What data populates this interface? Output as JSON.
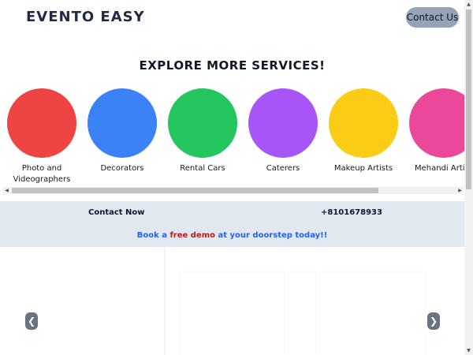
{
  "header": {
    "brand": "EVENTO EASY",
    "contact_button": "Contact Us"
  },
  "services": {
    "title": "EXPLORE MORE SERVICES!",
    "items": [
      {
        "label": "Photo and\nVideographers",
        "color": "#ef4444"
      },
      {
        "label": "Decorators",
        "color": "#3b82f6"
      },
      {
        "label": "Rental Cars",
        "color": "#22c55e"
      },
      {
        "label": "Caterers",
        "color": "#a855f7"
      },
      {
        "label": "Makeup Artists",
        "color": "#facc15"
      },
      {
        "label": "Mehandi Artists",
        "color": "#ec4899"
      }
    ]
  },
  "contact": {
    "label": "Contact Now",
    "phone": "+8101678933",
    "demo_prefix": "Book a",
    "demo_highlight": "free demo",
    "demo_suffix": "at your doorstep today!!"
  },
  "carousel": {
    "prev_glyph": "❮",
    "next_glyph": "❯"
  },
  "scrollbar_glyphs": {
    "left": "◀",
    "right": "▶",
    "up": "▲",
    "down": "▼"
  }
}
